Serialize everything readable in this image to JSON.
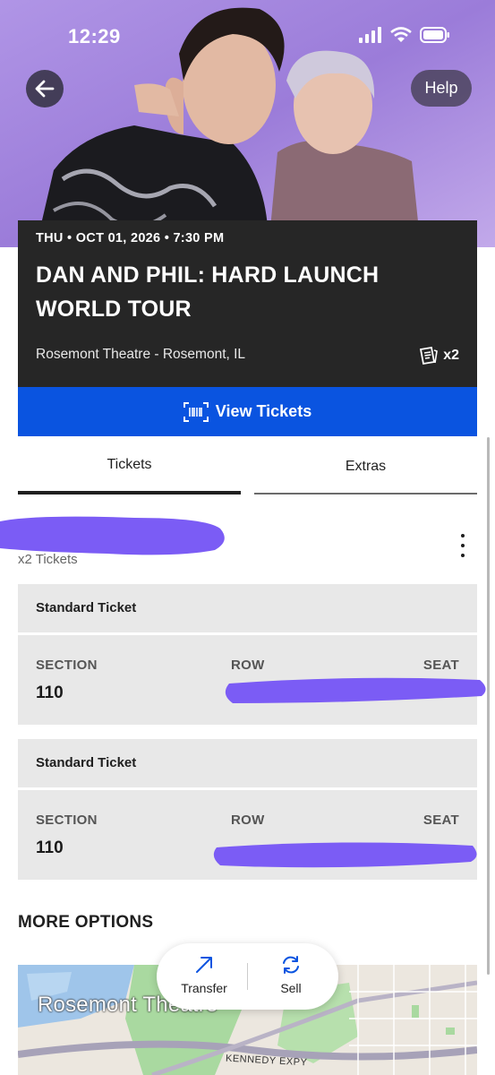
{
  "status_bar": {
    "time": "12:29"
  },
  "header": {
    "help_label": "Help"
  },
  "event": {
    "date": "THU • OCT 01, 2026 • 7:30 PM",
    "title": "DAN AND PHIL: HARD LAUNCH WORLD TOUR",
    "venue": "Rosemont Theatre - Rosemont, IL",
    "ticket_qty": "x2"
  },
  "actions": {
    "view_tickets_label": "View Tickets"
  },
  "tabs": [
    {
      "label": "Tickets",
      "active": true
    },
    {
      "label": "Extras",
      "active": false
    }
  ],
  "order": {
    "tickets_count": "x2 Tickets"
  },
  "tickets": [
    {
      "type": "Standard Ticket",
      "section_label": "SECTION",
      "section": "110",
      "row_label": "ROW",
      "seat_label": "SEAT"
    },
    {
      "type": "Standard Ticket",
      "section_label": "SECTION",
      "section": "110",
      "row_label": "ROW",
      "seat_label": "SEAT"
    }
  ],
  "more_options": {
    "heading": "MORE OPTIONS"
  },
  "map": {
    "venue_label": "Rosemont Theatre",
    "road_label": "KENNEDY EXPY"
  },
  "floating_actions": {
    "transfer_label": "Transfer",
    "sell_label": "Sell"
  },
  "colors": {
    "accent_blue": "#0a54e0",
    "card_dark": "#262626",
    "redaction_purple": "#7b5cf5",
    "hero_purple": "#a88be0"
  }
}
